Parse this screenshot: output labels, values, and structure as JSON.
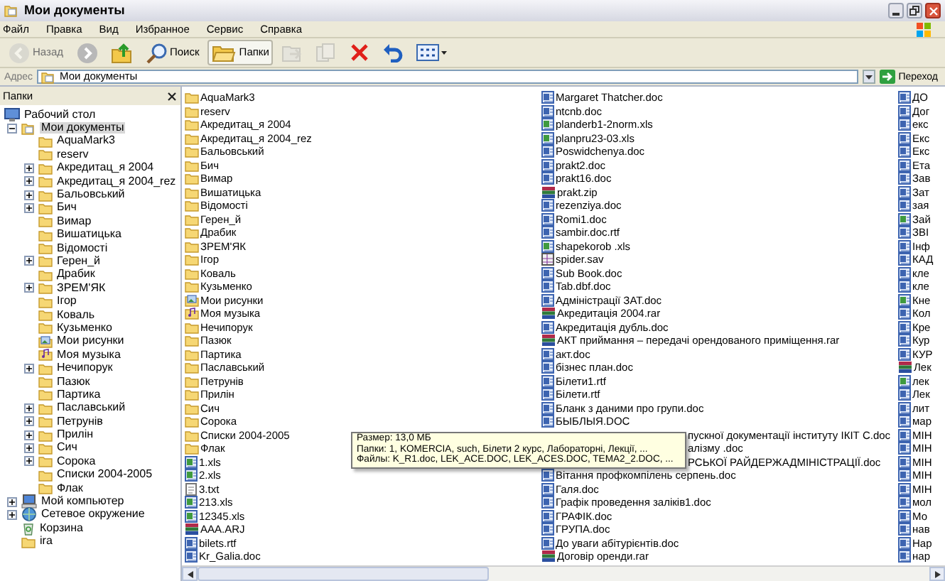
{
  "window": {
    "title": "Мои документы"
  },
  "menu": [
    "Файл",
    "Правка",
    "Вид",
    "Избранное",
    "Сервис",
    "Справка"
  ],
  "toolbar": [
    {
      "kind": "back",
      "label": "Назад",
      "disabled": true,
      "pressed": false
    },
    {
      "kind": "forward",
      "disabled": false,
      "pressed": false
    },
    {
      "kind": "up",
      "disabled": false,
      "pressed": false
    },
    {
      "kind": "search",
      "label": "Поиск",
      "disabled": false,
      "pressed": false
    },
    {
      "kind": "folders",
      "label": "Папки",
      "disabled": false,
      "pressed": true
    },
    {
      "kind": "move",
      "disabled": true,
      "pressed": false
    },
    {
      "kind": "copy",
      "disabled": true,
      "pressed": false
    },
    {
      "kind": "delete",
      "disabled": false,
      "pressed": false
    },
    {
      "kind": "undo",
      "disabled": false,
      "pressed": false
    },
    {
      "kind": "views",
      "disabled": false,
      "pressed": false
    }
  ],
  "address": {
    "label": "Адрес",
    "value": "Мои документы",
    "go_button": "Переход"
  },
  "folders_pane": {
    "title": "Папки",
    "tree": [
      {
        "label": "Рабочий стол",
        "kind": "desktop",
        "selected": false,
        "children": [
          {
            "label": "Мои документы",
            "kind": "documents",
            "selected": true,
            "expanded": true,
            "children": [
              {
                "label": "AquaMark3",
                "kind": "folder",
                "selected": false
              },
              {
                "label": "reserv",
                "kind": "folder",
                "selected": false
              },
              {
                "label": "Акредитац_я 2004",
                "kind": "folder",
                "selected": false,
                "expanded": false
              },
              {
                "label": "Акредитац_я 2004_rez",
                "kind": "folder",
                "selected": false,
                "expanded": false
              },
              {
                "label": "Бальовський",
                "kind": "folder",
                "selected": false,
                "expanded": false
              },
              {
                "label": "Бич",
                "kind": "folder",
                "selected": false,
                "expanded": false
              },
              {
                "label": "Вимар",
                "kind": "folder",
                "selected": false
              },
              {
                "label": "Вишатицька",
                "kind": "folder",
                "selected": false
              },
              {
                "label": "Відомості",
                "kind": "folder",
                "selected": false
              },
              {
                "label": "Герен_й",
                "kind": "folder",
                "selected": false,
                "expanded": false
              },
              {
                "label": "Драбик",
                "kind": "folder",
                "selected": false
              },
              {
                "label": "ЗРЕМ'ЯК",
                "kind": "folder",
                "selected": false,
                "expanded": false
              },
              {
                "label": "Ігор",
                "kind": "folder",
                "selected": false
              },
              {
                "label": "Коваль",
                "kind": "folder",
                "selected": false
              },
              {
                "label": "Кузьменко",
                "kind": "folder",
                "selected": false
              },
              {
                "label": "Мои рисунки",
                "kind": "pictures",
                "selected": false
              },
              {
                "label": "Моя музыка",
                "kind": "music",
                "selected": false
              },
              {
                "label": "Нечипорук",
                "kind": "folder",
                "selected": false,
                "expanded": false
              },
              {
                "label": "Пазюк",
                "kind": "folder",
                "selected": false
              },
              {
                "label": "Партика",
                "kind": "folder",
                "selected": false
              },
              {
                "label": "Паславський",
                "kind": "folder",
                "selected": false,
                "expanded": false
              },
              {
                "label": "Петрунів",
                "kind": "folder",
                "selected": false,
                "expanded": false
              },
              {
                "label": "Прилін",
                "kind": "folder",
                "selected": false,
                "expanded": false
              },
              {
                "label": "Сич",
                "kind": "folder",
                "selected": false,
                "expanded": false
              },
              {
                "label": "Сорока",
                "kind": "folder",
                "selected": false,
                "expanded": false
              },
              {
                "label": "Списки 2004-2005",
                "kind": "folder",
                "selected": false
              },
              {
                "label": "Флак",
                "kind": "folder",
                "selected": false
              }
            ]
          },
          {
            "label": "Мой компьютер",
            "kind": "computer",
            "selected": false,
            "expanded": false
          },
          {
            "label": "Сетевое окружение",
            "kind": "network",
            "selected": false,
            "expanded": false
          },
          {
            "label": "Корзина",
            "kind": "recycle",
            "selected": false
          },
          {
            "label": "ira",
            "kind": "folder",
            "selected": false
          }
        ]
      }
    ]
  },
  "file_list": {
    "columns": [
      [
        {
          "name": "AquaMark3",
          "kind": "folder"
        },
        {
          "name": "reserv",
          "kind": "folder"
        },
        {
          "name": "Акредитац_я 2004",
          "kind": "folder"
        },
        {
          "name": "Акредитац_я 2004_rez",
          "kind": "folder"
        },
        {
          "name": "Бальовський",
          "kind": "folder"
        },
        {
          "name": "Бич",
          "kind": "folder"
        },
        {
          "name": "Вимар",
          "kind": "folder"
        },
        {
          "name": "Вишатицька",
          "kind": "folder"
        },
        {
          "name": "Відомості",
          "kind": "folder"
        },
        {
          "name": "Герен_й",
          "kind": "folder"
        },
        {
          "name": "Драбик",
          "kind": "folder"
        },
        {
          "name": "ЗРЕМ'ЯК",
          "kind": "folder"
        },
        {
          "name": "Ігор",
          "kind": "folder"
        },
        {
          "name": "Коваль",
          "kind": "folder"
        },
        {
          "name": "Кузьменко",
          "kind": "folder"
        },
        {
          "name": "Мои рисунки",
          "kind": "pictures"
        },
        {
          "name": "Моя музыка",
          "kind": "music"
        },
        {
          "name": "Нечипорук",
          "kind": "folder"
        },
        {
          "name": "Пазюк",
          "kind": "folder"
        },
        {
          "name": "Партика",
          "kind": "folder"
        },
        {
          "name": "Паславський",
          "kind": "folder"
        },
        {
          "name": "Петрунів",
          "kind": "folder"
        },
        {
          "name": "Прилін",
          "kind": "folder"
        },
        {
          "name": "Сич",
          "kind": "folder"
        },
        {
          "name": "Сорока",
          "kind": "folder"
        },
        {
          "name": "Списки 2004-2005",
          "kind": "folder"
        },
        {
          "name": "Флак",
          "kind": "folder"
        },
        {
          "name": "1.xls",
          "kind": "xls"
        },
        {
          "name": "2.xls",
          "kind": "xls"
        },
        {
          "name": "3.txt",
          "kind": "txt"
        },
        {
          "name": "213.xls",
          "kind": "xls"
        },
        {
          "name": "12345.xls",
          "kind": "xls"
        },
        {
          "name": "AAA.ARJ",
          "kind": "archive"
        },
        {
          "name": "bilets.rtf",
          "kind": "doc"
        },
        {
          "name": "Kr_Galia.doc",
          "kind": "doc"
        }
      ],
      [
        {
          "name": "Margaret Thatcher.doc",
          "kind": "doc"
        },
        {
          "name": "ntcnb.doc",
          "kind": "doc"
        },
        {
          "name": "planderb1-2norm.xls",
          "kind": "xls"
        },
        {
          "name": "planpru23-03.xls",
          "kind": "xls"
        },
        {
          "name": "Poswidchenya.doc",
          "kind": "doc"
        },
        {
          "name": "prakt2.doc",
          "kind": "doc"
        },
        {
          "name": "prakt16.doc",
          "kind": "doc"
        },
        {
          "name": "prakt.zip",
          "kind": "archive"
        },
        {
          "name": "rezenziya.doc",
          "kind": "doc"
        },
        {
          "name": "Romi1.doc",
          "kind": "doc"
        },
        {
          "name": "sambir.doc.rtf",
          "kind": "doc"
        },
        {
          "name": "shapekorob .xls",
          "kind": "xls"
        },
        {
          "name": "spider.sav",
          "kind": "sav"
        },
        {
          "name": "Sub Book.doc",
          "kind": "doc"
        },
        {
          "name": "Tab.dbf.doc",
          "kind": "doc"
        },
        {
          "name": "Адміністрації ЗАТ.doc",
          "kind": "doc"
        },
        {
          "name": "Акредитація 2004.rar",
          "kind": "archive"
        },
        {
          "name": "Акредитація дубль.doc",
          "kind": "doc"
        },
        {
          "name": "АКТ приймання – передачі орендованого приміщення.rar",
          "kind": "archive"
        },
        {
          "name": "акт.doc",
          "kind": "doc"
        },
        {
          "name": "бізнес план.doc",
          "kind": "doc"
        },
        {
          "name": "Білети1.rtf",
          "kind": "doc"
        },
        {
          "name": "Білети.rtf",
          "kind": "doc"
        },
        {
          "name": "Бланк з даними про групи.doc",
          "kind": "doc"
        },
        {
          "name": "БЫБЛЫЯ.DOC",
          "kind": "doc"
        },
        {
          "name": "пускної документації інституту ІКІТ С.doc",
          "kind": "partial"
        },
        {
          "name": "алізму .doc",
          "kind": "partial"
        },
        {
          "name": "РСЬКОЇ  РАЙДЕРЖАДМІНІСТРАЦІЇ.doc",
          "kind": "partial"
        },
        {
          "name": "Вітання профкомпілень серпень.doc",
          "kind": "doc"
        },
        {
          "name": "Галя.doc",
          "kind": "doc"
        },
        {
          "name": "Графік проведення заліків1.doc",
          "kind": "doc"
        },
        {
          "name": "ГРАФІК.doc",
          "kind": "doc"
        },
        {
          "name": "ГРУПА.doc",
          "kind": "doc"
        },
        {
          "name": "До уваги абітурієнтів.doc",
          "kind": "doc"
        },
        {
          "name": "Договір оренди.rar",
          "kind": "archive"
        }
      ],
      [
        {
          "name": "ДО",
          "kind": "doc"
        },
        {
          "name": "Дог",
          "kind": "doc"
        },
        {
          "name": "екс",
          "kind": "doc"
        },
        {
          "name": "Екс",
          "kind": "doc"
        },
        {
          "name": "Екс",
          "kind": "doc"
        },
        {
          "name": "Ета",
          "kind": "doc"
        },
        {
          "name": "Зав",
          "kind": "doc"
        },
        {
          "name": "Зат",
          "kind": "doc"
        },
        {
          "name": "зая",
          "kind": "doc"
        },
        {
          "name": "Зай",
          "kind": "xls"
        },
        {
          "name": "ЗВІ",
          "kind": "doc"
        },
        {
          "name": "Інф",
          "kind": "doc"
        },
        {
          "name": "КАД",
          "kind": "doc"
        },
        {
          "name": "кле",
          "kind": "doc"
        },
        {
          "name": "кле",
          "kind": "doc"
        },
        {
          "name": "Кне",
          "kind": "xls"
        },
        {
          "name": "Кол",
          "kind": "doc"
        },
        {
          "name": "Кре",
          "kind": "doc"
        },
        {
          "name": "Кур",
          "kind": "doc"
        },
        {
          "name": "КУР",
          "kind": "doc"
        },
        {
          "name": "Лек",
          "kind": "archive"
        },
        {
          "name": "лек",
          "kind": "xls"
        },
        {
          "name": "Лек",
          "kind": "doc"
        },
        {
          "name": "лит",
          "kind": "doc"
        },
        {
          "name": "мар",
          "kind": "doc"
        },
        {
          "name": "МІН",
          "kind": "doc"
        },
        {
          "name": "МІН",
          "kind": "doc"
        },
        {
          "name": "МІН",
          "kind": "doc"
        },
        {
          "name": "МІН",
          "kind": "doc"
        },
        {
          "name": "МІН",
          "kind": "doc"
        },
        {
          "name": "мол",
          "kind": "doc"
        },
        {
          "name": "Мо",
          "kind": "doc"
        },
        {
          "name": "нав",
          "kind": "doc"
        },
        {
          "name": "Нар",
          "kind": "doc"
        },
        {
          "name": "нар",
          "kind": "doc"
        }
      ]
    ]
  },
  "tooltip": {
    "lines": [
      "Размер: 13,0 МБ",
      "Папки: 1, KOMERCIA, such, Білети 2 курс, Лабораторні, Лекції, ...",
      "Файлы: K_R1.doc, LEK_ACE.DOC, LEK_ACES.DOC, TEMA2_2.DOC, ..."
    ]
  }
}
